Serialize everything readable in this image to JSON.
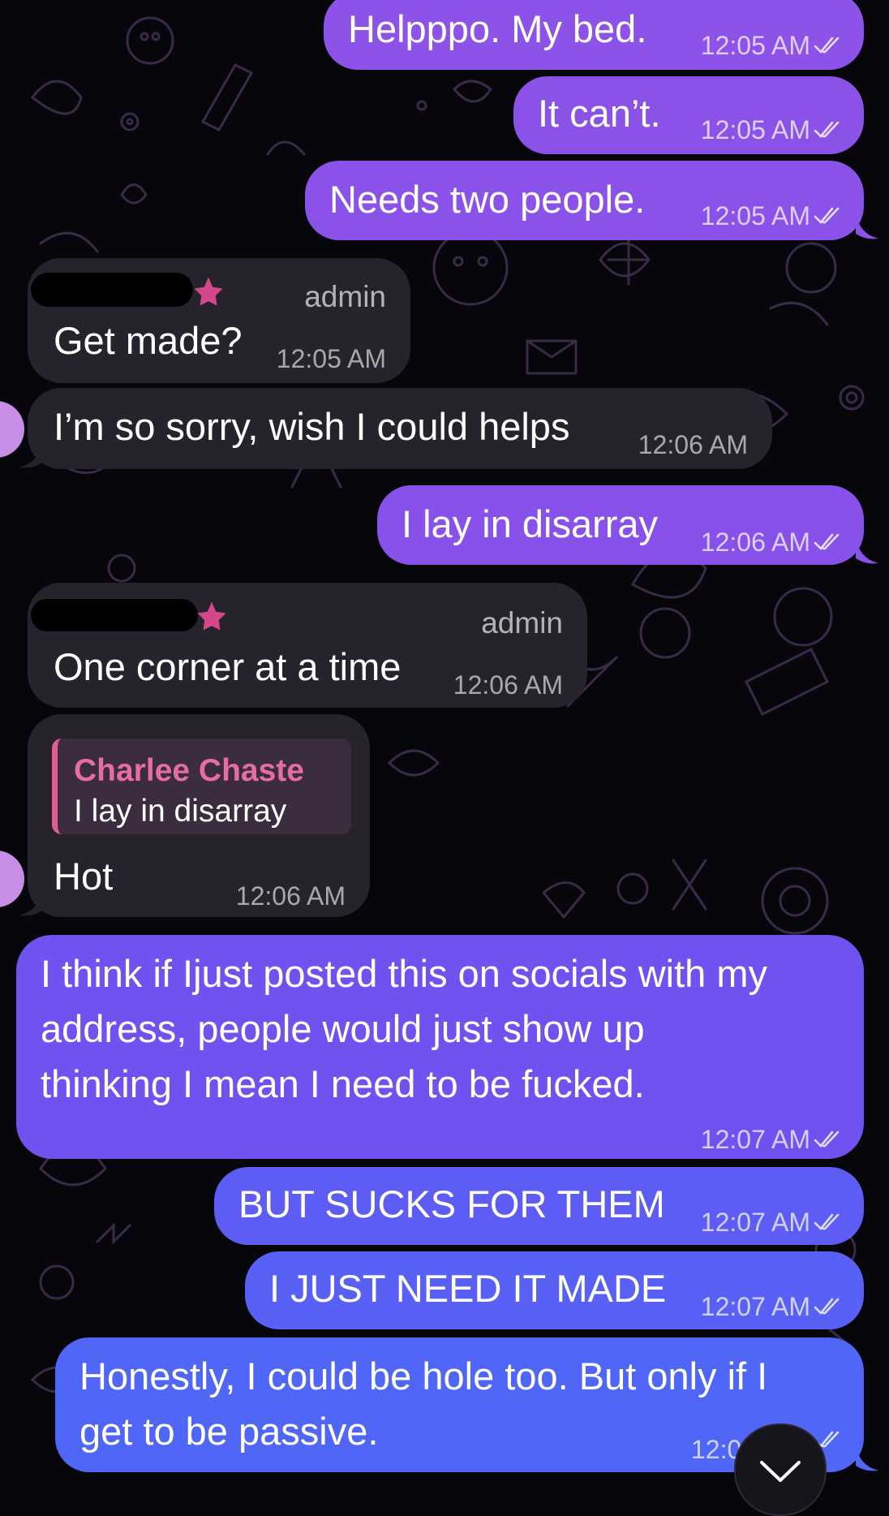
{
  "colors": {
    "outgoing_top": "#8b52e8",
    "outgoing_mid": "#6d52f1",
    "outgoing_bottom": "#4e66f6",
    "incoming": "#26232c",
    "reply_accent": "#e05e92"
  },
  "messages": [
    {
      "direction": "out",
      "text": "Helpppo. My bed.",
      "time": "12:05 AM"
    },
    {
      "direction": "out",
      "text": "It can’t.",
      "time": "12:05 AM"
    },
    {
      "direction": "out",
      "text": "Needs two people.",
      "time": "12:05 AM"
    },
    {
      "direction": "in",
      "role": "admin",
      "text": "Get made?",
      "time": "12:05 AM"
    },
    {
      "direction": "in",
      "text": "I’m so sorry, wish I could helps",
      "time": "12:06 AM"
    },
    {
      "direction": "out",
      "text": "I lay in disarray",
      "time": "12:06 AM"
    },
    {
      "direction": "in",
      "role": "admin",
      "text": "One corner at a time",
      "time": "12:06 AM"
    },
    {
      "direction": "in",
      "reply": {
        "name": "Charlee Chaste",
        "text": "I lay in disarray"
      },
      "text": "Hot",
      "time": "12:06 AM"
    },
    {
      "direction": "out",
      "lines": [
        "I think if Ijust posted this on socials with my",
        "address, people would just show up",
        "thinking I mean I need to be fucked."
      ],
      "time": "12:07 AM"
    },
    {
      "direction": "out",
      "text": "BUT SUCKS FOR THEM",
      "time": "12:07 AM"
    },
    {
      "direction": "out",
      "text": "I JUST NEED IT MADE",
      "time": "12:07 AM"
    },
    {
      "direction": "out",
      "lines": [
        "Honestly, I could be hole too. But only if I",
        "get to be passive."
      ],
      "time": "12:0"
    }
  ],
  "icons": {
    "read_receipt": "double-check-icon",
    "admin_badge": "star-icon",
    "scroll_down": "chevron-down-icon"
  }
}
